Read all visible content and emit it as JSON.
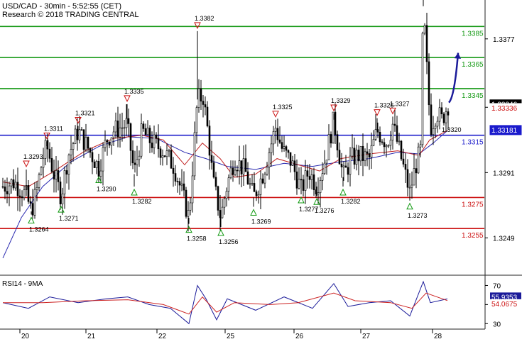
{
  "header": {
    "instrument_line": "USD/CAD - 30min - 5:52:55 (CET)",
    "copyright_line": "Research © 2018 TRADING CENTRAL"
  },
  "rsi_panel": {
    "label": "RSI14 - 9MA"
  },
  "chart_data": [
    {
      "type": "candlestick",
      "title": "USD/CAD - 30min - 5:52:55 (CET)",
      "ylim": [
        1.3225,
        1.3402
      ],
      "y_ticks": [
        1.3249,
        1.3291,
        1.3333,
        1.3377
      ],
      "y_tick_labels": [
        "1.3249",
        "1.3291",
        "1.3333",
        "1.3377"
      ],
      "x_tick_labels": [
        "20",
        "21",
        "22",
        "25",
        "26",
        "27",
        "28"
      ],
      "x_tick_pos": [
        34,
        127,
        227,
        323,
        420,
        514,
        615
      ],
      "levels": [
        {
          "value": 1.3385,
          "label": "1.3385",
          "color": "#159915"
        },
        {
          "value": 1.3365,
          "label": "1.3365",
          "color": "#159915"
        },
        {
          "value": 1.3345,
          "label": "1.3345",
          "color": "#159915"
        },
        {
          "value": 1.3315,
          "label": "1.3315",
          "color": "#2020cc"
        },
        {
          "value": 1.3275,
          "label": "1.3275",
          "color": "#cc1111"
        },
        {
          "value": 1.3255,
          "label": "1.3255",
          "color": "#cc1111"
        }
      ],
      "price_tags": [
        {
          "value": 1.33346,
          "label": "1.33346",
          "bg": "#000000",
          "fg": "#ffffff"
        },
        {
          "value": 1.33336,
          "label": "1.33336",
          "bg": "#ffffff",
          "fg": "#cc1111"
        },
        {
          "value": 1.33181,
          "label": "1.33181",
          "bg": "#1a1acc",
          "fg": "#ffffff"
        }
      ],
      "highs": [
        {
          "slot": 37,
          "value": 1.3293,
          "label": "1.3293"
        },
        {
          "slot": 66,
          "value": 1.3311,
          "label": "1.3311"
        },
        {
          "slot": 110,
          "value": 1.3321,
          "label": "1.3321"
        },
        {
          "slot": 179,
          "value": 1.3335,
          "label": "1.3335"
        },
        {
          "slot": 278,
          "value": 1.3382,
          "label": "1.3382"
        },
        {
          "slot": 388,
          "value": 1.3325,
          "label": "1.3325"
        },
        {
          "slot": 470,
          "value": 1.3329,
          "label": "1.3329"
        },
        {
          "slot": 531,
          "value": 1.3326,
          "label": "1.3326"
        },
        {
          "slot": 553,
          "value": 1.3327,
          "label": "1.3327"
        },
        {
          "slot": 596,
          "value": 1.3405,
          "label": ""
        }
      ],
      "lows": [
        {
          "slot": 44,
          "value": 1.3264,
          "label": "1.3264"
        },
        {
          "slot": 86,
          "value": 1.3271,
          "label": "1.3271"
        },
        {
          "slot": 139,
          "value": 1.329,
          "label": "1.3290"
        },
        {
          "slot": 189,
          "value": 1.3282,
          "label": "1.3282"
        },
        {
          "slot": 266,
          "value": 1.3258,
          "label": "1.3258"
        },
        {
          "slot": 311,
          "value": 1.3256,
          "label": "1.3256"
        },
        {
          "slot": 357,
          "value": 1.3269,
          "label": "1.3269"
        },
        {
          "slot": 424,
          "value": 1.3277,
          "label": "1.3277"
        },
        {
          "slot": 446,
          "value": 1.3276,
          "label": "1.3276"
        },
        {
          "slot": 483,
          "value": 1.3282,
          "label": "1.3282"
        },
        {
          "slot": 577,
          "value": 1.3273,
          "label": "1.3273"
        }
      ],
      "annotations": [
        {
          "slot": 622,
          "value": 1.332,
          "label": "1.3320"
        }
      ],
      "forecast_arrow": {
        "from": [
          632,
          1.3336
        ],
        "to": [
          645,
          1.3368
        ]
      },
      "price_path": [
        [
          4,
          1.3282
        ],
        [
          20,
          1.3285
        ],
        [
          37,
          1.3276
        ],
        [
          44,
          1.3266
        ],
        [
          52,
          1.328
        ],
        [
          60,
          1.33
        ],
        [
          66,
          1.3308
        ],
        [
          76,
          1.329
        ],
        [
          86,
          1.3276
        ],
        [
          96,
          1.3302
        ],
        [
          110,
          1.3318
        ],
        [
          120,
          1.331
        ],
        [
          132,
          1.33
        ],
        [
          139,
          1.3294
        ],
        [
          150,
          1.3312
        ],
        [
          160,
          1.3318
        ],
        [
          170,
          1.332
        ],
        [
          179,
          1.3322
        ],
        [
          189,
          1.329
        ],
        [
          200,
          1.3318
        ],
        [
          210,
          1.3312
        ],
        [
          230,
          1.3305
        ],
        [
          245,
          1.3295
        ],
        [
          255,
          1.328
        ],
        [
          266,
          1.3262
        ],
        [
          272,
          1.33
        ],
        [
          278,
          1.3338
        ],
        [
          286,
          1.334
        ],
        [
          293,
          1.3316
        ],
        [
          300,
          1.3285
        ],
        [
          311,
          1.3262
        ],
        [
          318,
          1.328
        ],
        [
          330,
          1.33
        ],
        [
          345,
          1.3292
        ],
        [
          357,
          1.3275
        ],
        [
          370,
          1.329
        ],
        [
          388,
          1.332
        ],
        [
          398,
          1.3305
        ],
        [
          410,
          1.3298
        ],
        [
          424,
          1.328
        ],
        [
          435,
          1.3292
        ],
        [
          446,
          1.3282
        ],
        [
          458,
          1.33
        ],
        [
          470,
          1.3325
        ],
        [
          483,
          1.3288
        ],
        [
          495,
          1.33
        ],
        [
          505,
          1.3302
        ],
        [
          520,
          1.33
        ],
        [
          531,
          1.3318
        ],
        [
          545,
          1.331
        ],
        [
          553,
          1.3322
        ],
        [
          565,
          1.33
        ],
        [
          577,
          1.3278
        ],
        [
          585,
          1.3295
        ],
        [
          592,
          1.3305
        ],
        [
          596,
          1.3398
        ],
        [
          600,
          1.3365
        ],
        [
          606,
          1.332
        ],
        [
          615,
          1.333
        ],
        [
          622,
          1.3325
        ],
        [
          632,
          1.3336
        ]
      ],
      "ma_red": [
        [
          4,
          1.3285
        ],
        [
          40,
          1.3282
        ],
        [
          80,
          1.3293
        ],
        [
          120,
          1.3305
        ],
        [
          160,
          1.3313
        ],
        [
          200,
          1.3315
        ],
        [
          230,
          1.3312
        ],
        [
          260,
          1.3296
        ],
        [
          285,
          1.331
        ],
        [
          310,
          1.33
        ],
        [
          330,
          1.3288
        ],
        [
          360,
          1.329
        ],
        [
          390,
          1.33
        ],
        [
          420,
          1.3296
        ],
        [
          450,
          1.3292
        ],
        [
          480,
          1.33
        ],
        [
          520,
          1.3303
        ],
        [
          560,
          1.3305
        ],
        [
          590,
          1.3302
        ],
        [
          605,
          1.3312
        ],
        [
          630,
          1.3318
        ]
      ],
      "ma_blue": [
        [
          4,
          1.3236
        ],
        [
          30,
          1.3262
        ],
        [
          60,
          1.3282
        ],
        [
          100,
          1.3298
        ],
        [
          140,
          1.3308
        ],
        [
          180,
          1.3314
        ],
        [
          220,
          1.3313
        ],
        [
          260,
          1.3304
        ],
        [
          290,
          1.33
        ],
        [
          320,
          1.3295
        ],
        [
          360,
          1.3293
        ],
        [
          400,
          1.3297
        ],
        [
          440,
          1.3295
        ],
        [
          480,
          1.3298
        ],
        [
          520,
          1.33
        ],
        [
          560,
          1.3304
        ],
        [
          590,
          1.3303
        ],
        [
          610,
          1.331
        ],
        [
          630,
          1.3318
        ]
      ]
    },
    {
      "type": "line",
      "title": "RSI14 - 9MA",
      "ylim": [
        25,
        80
      ],
      "y_ticks": [
        70,
        50,
        30
      ],
      "y_tick_labels": [
        "70",
        "50",
        "30"
      ],
      "series": [
        {
          "color": "#1a1a99",
          "points": [
            [
              4,
              52
            ],
            [
              40,
              46
            ],
            [
              70,
              58
            ],
            [
              110,
              52
            ],
            [
              150,
              56
            ],
            [
              180,
              58
            ],
            [
              210,
              50
            ],
            [
              240,
              46
            ],
            [
              266,
              30
            ],
            [
              278,
              70
            ],
            [
              290,
              56
            ],
            [
              305,
              34
            ],
            [
              320,
              56
            ],
            [
              360,
              44
            ],
            [
              400,
              58
            ],
            [
              440,
              46
            ],
            [
              470,
              72
            ],
            [
              490,
              48
            ],
            [
              520,
              52
            ],
            [
              550,
              54
            ],
            [
              577,
              38
            ],
            [
              596,
              74
            ],
            [
              606,
              52
            ],
            [
              630,
              55.9
            ]
          ]
        },
        {
          "color": "#cc2222",
          "points": [
            [
              4,
              52
            ],
            [
              60,
              52
            ],
            [
              120,
              54
            ],
            [
              180,
              55
            ],
            [
              230,
              50
            ],
            [
              266,
              40
            ],
            [
              285,
              58
            ],
            [
              305,
              42
            ],
            [
              330,
              52
            ],
            [
              380,
              50
            ],
            [
              420,
              52
            ],
            [
              470,
              62
            ],
            [
              500,
              54
            ],
            [
              550,
              52
            ],
            [
              580,
              46
            ],
            [
              600,
              62
            ],
            [
              630,
              54.1
            ]
          ]
        }
      ],
      "price_tags": [
        {
          "value": 55.9353,
          "label": "55.9353",
          "bg": "#1a1a99",
          "fg": "#ffffff"
        },
        {
          "value": 54.0675,
          "label": "54.0675",
          "bg": "#ffffff",
          "fg": "#cc1111"
        }
      ]
    }
  ]
}
